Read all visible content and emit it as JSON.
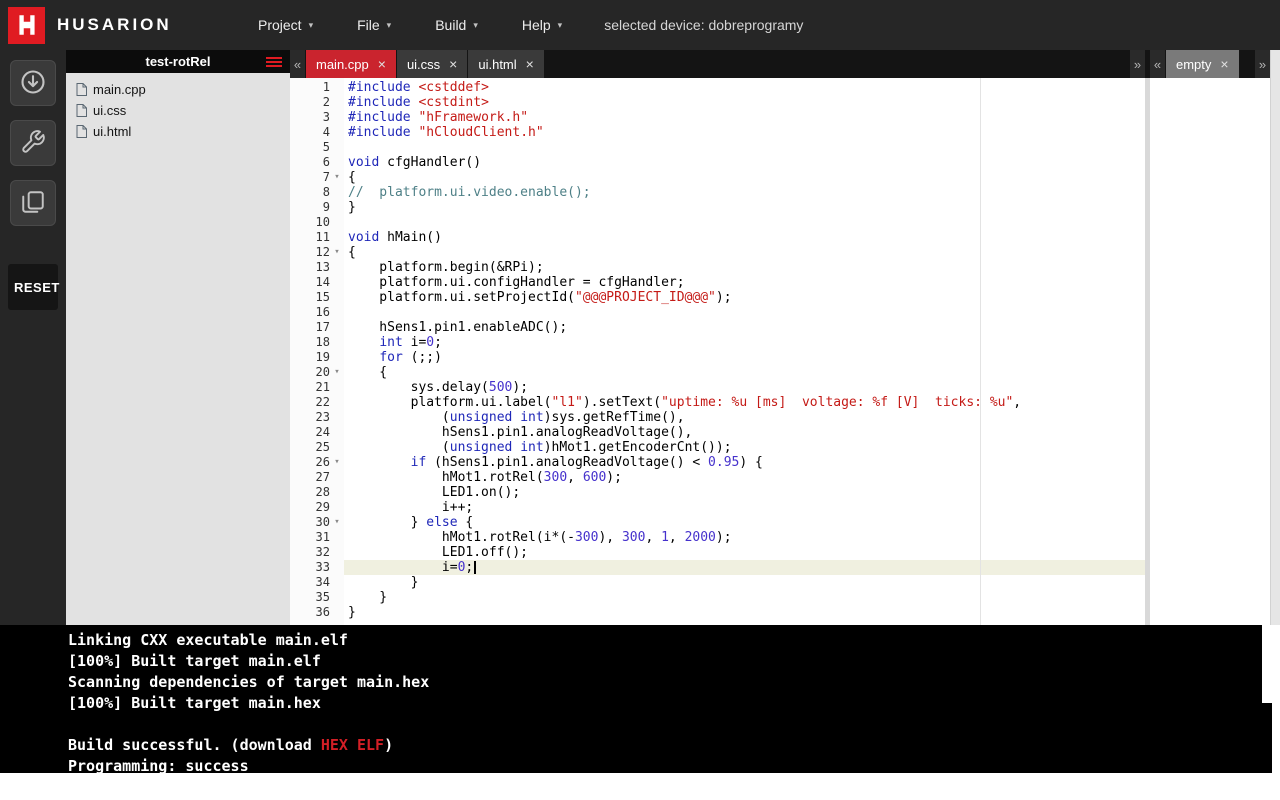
{
  "topbar": {
    "brand": "HUSARION",
    "caret": "▾",
    "menus": [
      "Project",
      "File",
      "Build",
      "Help"
    ],
    "device_label": "selected device: dobreprogramy"
  },
  "sidebar": {
    "icons": [
      "flash-icon",
      "wrench-icon",
      "logs-icon"
    ],
    "reset_label": "RESET"
  },
  "file_panel": {
    "project_name": "test-rotRel",
    "files": [
      "main.cpp",
      "ui.css",
      "ui.html"
    ]
  },
  "editor": {
    "scroll_left": "«",
    "scroll_right": "»",
    "primary_tabs": [
      {
        "label": "main.cpp",
        "close": "×",
        "state": "active"
      },
      {
        "label": "ui.css",
        "close": "×",
        "state": ""
      },
      {
        "label": "ui.html",
        "close": "×",
        "state": ""
      }
    ],
    "secondary_tabs": [
      {
        "label": "empty",
        "close": "×",
        "state": "gray"
      }
    ],
    "active_line": 33,
    "cursor_line": 33,
    "fold_lines": [
      7,
      12,
      20,
      26,
      30
    ],
    "fold_glyph": "▾",
    "lines": [
      [
        [
          "k",
          "#include "
        ],
        [
          "s",
          "<cstddef>"
        ]
      ],
      [
        [
          "k",
          "#include "
        ],
        [
          "s",
          "<cstdint>"
        ]
      ],
      [
        [
          "k",
          "#include "
        ],
        [
          "s",
          "\"hFramework.h\""
        ]
      ],
      [
        [
          "k",
          "#include "
        ],
        [
          "s",
          "\"hCloudClient.h\""
        ]
      ],
      [],
      [
        [
          "k",
          "void"
        ],
        [
          "d",
          " cfgHandler()"
        ]
      ],
      [
        [
          "d",
          "{"
        ]
      ],
      [
        [
          "c",
          "//  platform.ui.video.enable();"
        ]
      ],
      [
        [
          "d",
          "}"
        ]
      ],
      [],
      [
        [
          "k",
          "void"
        ],
        [
          "d",
          " hMain()"
        ]
      ],
      [
        [
          "d",
          "{"
        ]
      ],
      [
        [
          "d",
          "    platform.begin(&RPi);"
        ]
      ],
      [
        [
          "d",
          "    platform.ui.configHandler = cfgHandler;"
        ]
      ],
      [
        [
          "d",
          "    platform.ui.setProjectId("
        ],
        [
          "s",
          "\"@@@PROJECT_ID@@@\""
        ],
        [
          "d",
          ");"
        ]
      ],
      [],
      [
        [
          "d",
          "    hSens1.pin1.enableADC();"
        ]
      ],
      [
        [
          "d",
          "    "
        ],
        [
          "k",
          "int"
        ],
        [
          "d",
          " i="
        ],
        [
          "n",
          "0"
        ],
        [
          "d",
          ";"
        ]
      ],
      [
        [
          "d",
          "    "
        ],
        [
          "k",
          "for"
        ],
        [
          "d",
          " (;;)"
        ]
      ],
      [
        [
          "d",
          "    {"
        ]
      ],
      [
        [
          "d",
          "        sys.delay("
        ],
        [
          "n",
          "500"
        ],
        [
          "d",
          ");"
        ]
      ],
      [
        [
          "d",
          "        platform.ui.label("
        ],
        [
          "s",
          "\"l1\""
        ],
        [
          "d",
          ").setText("
        ],
        [
          "s",
          "\"uptime: %u [ms]  voltage: %f [V]  ticks: %u\""
        ],
        [
          "d",
          ","
        ]
      ],
      [
        [
          "d",
          "            ("
        ],
        [
          "k",
          "unsigned"
        ],
        [
          "d",
          " "
        ],
        [
          "k",
          "int"
        ],
        [
          "d",
          ")sys.getRefTime(),"
        ]
      ],
      [
        [
          "d",
          "            hSens1.pin1.analogReadVoltage(),"
        ]
      ],
      [
        [
          "d",
          "            ("
        ],
        [
          "k",
          "unsigned"
        ],
        [
          "d",
          " "
        ],
        [
          "k",
          "int"
        ],
        [
          "d",
          ")hMot1.getEncoderCnt());"
        ]
      ],
      [
        [
          "d",
          "        "
        ],
        [
          "k",
          "if"
        ],
        [
          "d",
          " (hSens1.pin1.analogReadVoltage() < "
        ],
        [
          "n",
          "0.95"
        ],
        [
          "d",
          ") {"
        ]
      ],
      [
        [
          "d",
          "            hMot1.rotRel("
        ],
        [
          "n",
          "300"
        ],
        [
          "d",
          ", "
        ],
        [
          "n",
          "600"
        ],
        [
          "d",
          ");"
        ]
      ],
      [
        [
          "d",
          "            LED1.on();"
        ]
      ],
      [
        [
          "d",
          "            i++;"
        ]
      ],
      [
        [
          "d",
          "        } "
        ],
        [
          "k",
          "else"
        ],
        [
          "d",
          " {"
        ]
      ],
      [
        [
          "d",
          "            hMot1.rotRel(i*(-"
        ],
        [
          "n",
          "300"
        ],
        [
          "d",
          "), "
        ],
        [
          "n",
          "300"
        ],
        [
          "d",
          ", "
        ],
        [
          "n",
          "1"
        ],
        [
          "d",
          ", "
        ],
        [
          "n",
          "2000"
        ],
        [
          "d",
          ");"
        ]
      ],
      [
        [
          "d",
          "            LED1.off();"
        ]
      ],
      [
        [
          "d",
          "            i="
        ],
        [
          "n",
          "0"
        ],
        [
          "d",
          ";"
        ]
      ],
      [
        [
          "d",
          "        }"
        ]
      ],
      [
        [
          "d",
          "    }"
        ]
      ],
      [
        [
          "d",
          "}"
        ]
      ]
    ]
  },
  "console": {
    "lines": [
      [
        [
          "t",
          "Linking CXX executable main.elf"
        ]
      ],
      [
        [
          "t",
          "[100%] Built target main.elf"
        ]
      ],
      [
        [
          "t",
          "Scanning dependencies of target main.hex"
        ]
      ],
      [
        [
          "t",
          "[100%] Built target main.hex"
        ]
      ],
      [
        [
          "t",
          ""
        ]
      ],
      [
        [
          "t",
          "Build successful. (download "
        ],
        [
          "link",
          "HEX"
        ],
        [
          "t",
          " "
        ],
        [
          "link",
          "ELF"
        ],
        [
          "t",
          ")"
        ]
      ],
      [
        [
          "t",
          "Programming: success"
        ]
      ]
    ]
  },
  "colors": {
    "topbar_bg": "#262626",
    "accent_red": "#e01b22",
    "active_tab_red": "#ca242e",
    "keyword": "#1f27b8",
    "string": "#c41a16",
    "number": "#4531cc",
    "comment": "#4e8087",
    "console_link_red": "#d41f26",
    "active_line_bg": "#f0f0e0"
  }
}
